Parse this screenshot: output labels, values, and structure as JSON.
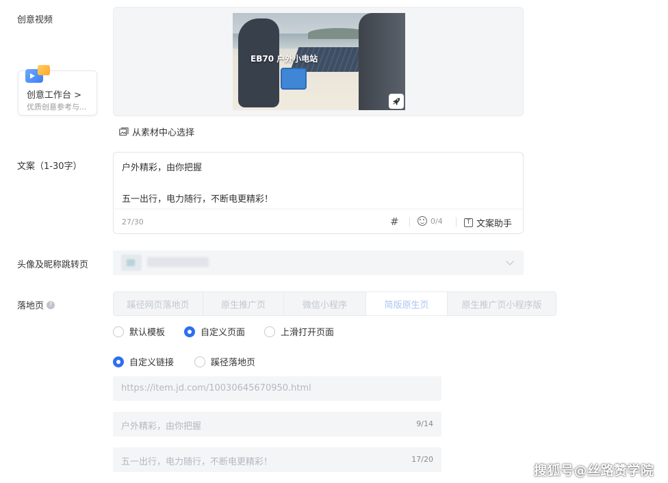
{
  "labels": {
    "creative_video": "创意视频",
    "copy": "文案（1-30字）",
    "avatar_jump": "头像及昵称跳转页",
    "landing": "落地页",
    "help": "?"
  },
  "workbench": {
    "title": "创意工作台 >",
    "subtitle": "优质创意参考与..."
  },
  "video": {
    "overlay_text": "EB70 户外小电站"
  },
  "material_link": "从素材中心选择",
  "copy_editor": {
    "line1": "户外精彩，由你把握",
    "line2": "五一出行，电力随行，不断电更精彩！",
    "counter": "27/30",
    "hash_symbol": "#",
    "emoji_count": "0/4",
    "t_glyph": "T",
    "assistant_label": "文案助手"
  },
  "landing_tabs": [
    {
      "label": "蹊径网页落地页",
      "active": false
    },
    {
      "label": "原生推广页",
      "active": false
    },
    {
      "label": "微信小程序",
      "active": false
    },
    {
      "label": "简版原生页",
      "active": true
    },
    {
      "label": "原生推广页小程序版",
      "active": false
    }
  ],
  "page_type_options": [
    {
      "label": "默认模板",
      "selected": false
    },
    {
      "label": "自定义页面",
      "selected": true
    },
    {
      "label": "上滑打开页面",
      "selected": false
    }
  ],
  "link_type_options": [
    {
      "label": "自定义链接",
      "selected": true
    },
    {
      "label": "蹊径落地页",
      "selected": false
    }
  ],
  "fields": {
    "url_placeholder": "https://item.jd.com/10030645670950.html",
    "title_placeholder": "户外精彩，由你把握",
    "title_count": "9/14",
    "desc_placeholder": "五一出行，电力随行，不断电更精彩！",
    "desc_count": "17/20"
  },
  "watermark": "搜狐号@丝路赞学院",
  "colors": {
    "primary": "#2e6ff0",
    "tab_active_text": "#a9c6f2",
    "field_bg": "#f4f5f7"
  },
  "icons": [
    "rocket-icon",
    "image-folder-icon",
    "hash-icon",
    "emoji-icon",
    "text-icon",
    "chevron-down-icon",
    "help-icon"
  ]
}
